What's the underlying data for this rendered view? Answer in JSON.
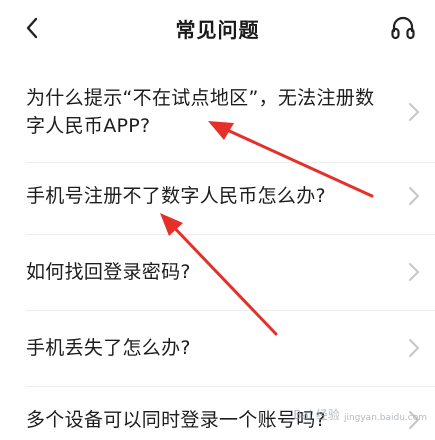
{
  "header": {
    "title": "常见问题",
    "back_icon": "chevron-left-icon",
    "right_icon": "headset-icon"
  },
  "faq": {
    "items": [
      {
        "label": "为什么提示“不在试点地区”，无法注册数字人民币APP?"
      },
      {
        "label": "手机号注册不了数字人民币怎么办?"
      },
      {
        "label": "如何找回登录密码?"
      },
      {
        "label": "手机丢失了怎么办?"
      },
      {
        "label": "多个设备可以同时登录一个账号吗?"
      }
    ]
  },
  "annotation": {
    "arrow_color": "#e5302a"
  },
  "watermark": {
    "text": "Bai 经验",
    "url": "jingyan.baidu.com"
  }
}
